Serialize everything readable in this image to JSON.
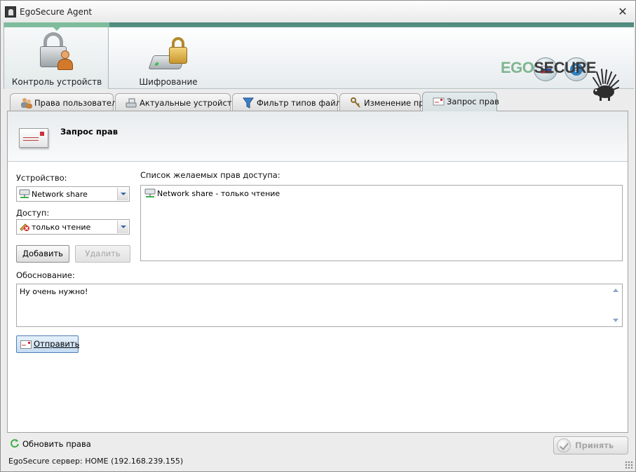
{
  "window": {
    "title": "EgoSecure Agent"
  },
  "header": {
    "nav": [
      {
        "label": "Контроль устройств",
        "selected": true
      },
      {
        "label": "Шифрование",
        "selected": false
      }
    ],
    "logo": {
      "part1": "EGO",
      "part2": "SECURE"
    },
    "language_flag": "russia-flag-icon",
    "help_icon": "help-icon"
  },
  "tabs": [
    {
      "label": "Права пользователя",
      "icon": "users-icon"
    },
    {
      "label": "Актуальные устройства",
      "icon": "devices-icon"
    },
    {
      "label": "Фильтр типов файлов",
      "icon": "filter-icon"
    },
    {
      "label": "Изменение прав",
      "icon": "keys-icon"
    },
    {
      "label": "Запрос прав",
      "icon": "envelope-icon",
      "active": true
    }
  ],
  "panel": {
    "title": "Запрос прав",
    "device_label": "Устройство:",
    "device_value": "Network share",
    "access_label": "Доступ:",
    "access_value": "только чтение",
    "add_button": "Добавить",
    "remove_button": "Удалить",
    "rights_list_label": "Список желаемых прав доступа:",
    "rights_list": [
      "Network share - только чтение"
    ],
    "reason_label": "Обоснование:",
    "reason_value": "Ну очень нужно!",
    "send_button": "Отправить"
  },
  "footer": {
    "refresh_link": "Обновить права",
    "accept_button": "Принять",
    "status": "EgoSecure сервер: HOME (192.168.239.155)"
  },
  "colors": {
    "accent_green": "#7ebc9d",
    "header_band": "#4d877c",
    "send_button_border": "#4f7fb5"
  }
}
